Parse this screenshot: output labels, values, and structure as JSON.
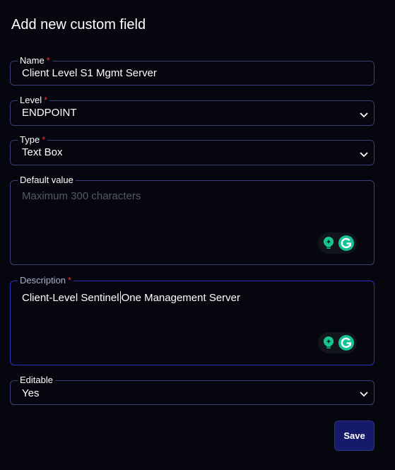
{
  "dialog": {
    "title": "Add new custom field"
  },
  "fields": {
    "name": {
      "label": "Name",
      "required": "*",
      "value": "Client Level S1 Mgmt Server"
    },
    "level": {
      "label": "Level",
      "required": "*",
      "value": "ENDPOINT"
    },
    "type": {
      "label": "Type",
      "required": "*",
      "value": "Text Box"
    },
    "default_value": {
      "label": "Default value",
      "placeholder": "Maximum 300 characters",
      "value": ""
    },
    "description": {
      "label": "Description",
      "required": "*",
      "value_before_cursor": "Client-Level Sentinel",
      "value_after_cursor": "One Management Server"
    },
    "editable": {
      "label": "Editable",
      "value": "Yes"
    }
  },
  "buttons": {
    "save_label": "Save"
  },
  "icons": {
    "dropdown": "chevron-down-icon",
    "assist": "lightbulb-icon",
    "grammarly": "grammarly-icon"
  },
  "colors": {
    "background": "#06060f",
    "border": "#3c3e78",
    "focus_border": "#2c30b8",
    "required": "#e5333d",
    "save_bg": "#151a6a",
    "assist_green": "#14c98d",
    "grammarly_green": "#15c39a"
  }
}
